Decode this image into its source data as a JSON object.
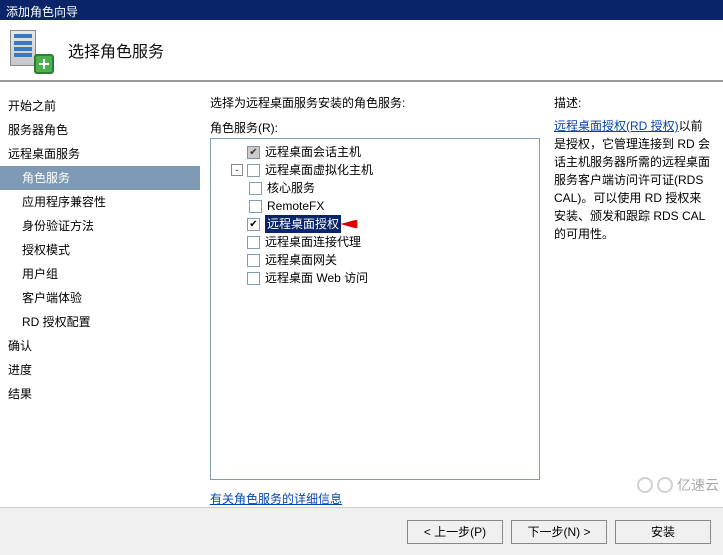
{
  "window": {
    "title": "添加角色向导"
  },
  "header": {
    "title": "选择角色服务"
  },
  "sidebar": [
    {
      "label": "开始之前",
      "level": 0,
      "active": false
    },
    {
      "label": "服务器角色",
      "level": 0,
      "active": false
    },
    {
      "label": "远程桌面服务",
      "level": 0,
      "active": false
    },
    {
      "label": "角色服务",
      "level": 1,
      "active": true
    },
    {
      "label": "应用程序兼容性",
      "level": 1,
      "active": false
    },
    {
      "label": "身份验证方法",
      "level": 1,
      "active": false
    },
    {
      "label": "授权模式",
      "level": 1,
      "active": false
    },
    {
      "label": "用户组",
      "level": 1,
      "active": false
    },
    {
      "label": "客户端体验",
      "level": 1,
      "active": false
    },
    {
      "label": "RD 授权配置",
      "level": 1,
      "active": false
    },
    {
      "label": "确认",
      "level": 0,
      "active": false
    },
    {
      "label": "进度",
      "level": 0,
      "active": false
    },
    {
      "label": "结果",
      "level": 0,
      "active": false
    }
  ],
  "main": {
    "prompt": "选择为远程桌面服务安装的角色服务:",
    "role_services_label": "角色服务(R):",
    "tree": [
      {
        "indent": 0,
        "toggle": "",
        "checked": true,
        "disabled": true,
        "label": "远程桌面会话主机",
        "selected": false
      },
      {
        "indent": 0,
        "toggle": "-",
        "checked": false,
        "disabled": false,
        "label": "远程桌面虚拟化主机",
        "selected": false
      },
      {
        "indent": 1,
        "toggle": "",
        "checked": false,
        "disabled": false,
        "label": "核心服务",
        "selected": false
      },
      {
        "indent": 1,
        "toggle": "",
        "checked": false,
        "disabled": false,
        "label": "RemoteFX",
        "selected": false
      },
      {
        "indent": 0,
        "toggle": "",
        "checked": true,
        "disabled": false,
        "label": "远程桌面授权",
        "selected": true,
        "arrow": true
      },
      {
        "indent": 0,
        "toggle": "",
        "checked": false,
        "disabled": false,
        "label": "远程桌面连接代理",
        "selected": false
      },
      {
        "indent": 0,
        "toggle": "",
        "checked": false,
        "disabled": false,
        "label": "远程桌面网关",
        "selected": false
      },
      {
        "indent": 0,
        "toggle": "",
        "checked": false,
        "disabled": false,
        "label": "远程桌面 Web 访问",
        "selected": false
      }
    ],
    "details_link": "有关角色服务的详细信息"
  },
  "description": {
    "label": "描述:",
    "link_text": "远程桌面授权(RD 授权)",
    "body": "以前是授权，它管理连接到 RD 会话主机服务器所需的远程桌面服务客户端访问许可证(RDS CAL)。可以使用 RD 授权来安装、颁发和跟踪 RDS CAL 的可用性。"
  },
  "buttons": {
    "prev": "< 上一步(P)",
    "next": "下一步(N) >",
    "install": "安装"
  },
  "watermark": "亿速云"
}
